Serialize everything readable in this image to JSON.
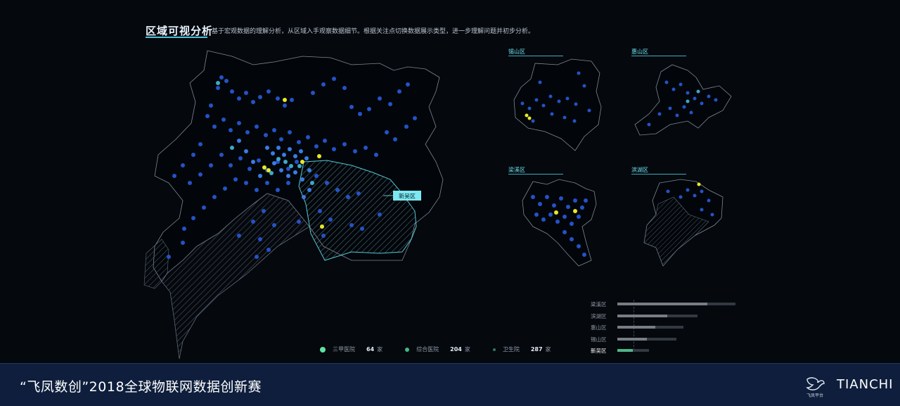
{
  "header": {
    "title": "区域可视分析",
    "subtitle": "基于宏观数据的理解分析，从区域入手观察数据细节。根据关注点切换数据展示类型，进一步理解问题并初步分析。"
  },
  "main_map": {
    "highlight_label": "新吴区"
  },
  "districts": [
    {
      "name": "锡山区"
    },
    {
      "name": "惠山区"
    },
    {
      "name": "梁溪区"
    },
    {
      "name": "滨湖区"
    }
  ],
  "legend": [
    {
      "label": "三甲医院",
      "count": "64",
      "unit": "家",
      "color": "#5fe3a1"
    },
    {
      "label": "综合医院",
      "count": "204",
      "unit": "家",
      "color": "#43b982"
    },
    {
      "label": "卫生院",
      "count": "287",
      "unit": "家",
      "color": "#2e7a5e"
    }
  ],
  "comparison": {
    "rows": [
      {
        "label": "梁溪区",
        "value": 0.76,
        "total": 1.0,
        "active": false
      },
      {
        "label": "滨湖区",
        "value": 0.42,
        "total": 0.68,
        "active": false
      },
      {
        "label": "惠山区",
        "value": 0.32,
        "total": 0.56,
        "active": false
      },
      {
        "label": "锡山区",
        "value": 0.25,
        "total": 0.5,
        "active": false
      },
      {
        "label": "新吴区",
        "value": 0.13,
        "total": 0.27,
        "active": true
      }
    ]
  },
  "footer": {
    "title": "“飞凤数创”2018全球物联网数据创新赛",
    "logo_text": "飞凤平台",
    "brand": "TIANCHI"
  },
  "colors": {
    "accent": "#47c4d8",
    "hex_dark": "#1f3fa8",
    "hex_mid": "#2f62d8",
    "hex_bright": "#e8e82a",
    "hex_teal": "#3fa8c8"
  }
}
